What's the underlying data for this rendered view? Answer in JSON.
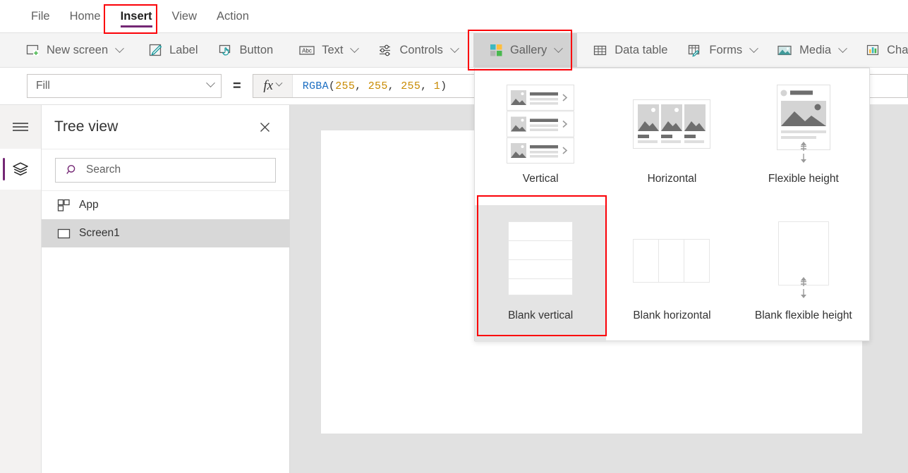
{
  "menubar": {
    "items": [
      {
        "label": "File",
        "active": false
      },
      {
        "label": "Home",
        "active": false
      },
      {
        "label": "Insert",
        "active": true
      },
      {
        "label": "View",
        "active": false
      },
      {
        "label": "Action",
        "active": false
      }
    ]
  },
  "toolbar": {
    "items": [
      {
        "label": "New screen",
        "icon": "new-screen-icon",
        "caret": true,
        "selected": false
      },
      {
        "label": "Label",
        "icon": "label-icon",
        "caret": false,
        "selected": false
      },
      {
        "label": "Button",
        "icon": "button-icon",
        "caret": false,
        "selected": false
      },
      {
        "label": "Text",
        "icon": "text-abc-icon",
        "caret": true,
        "selected": false
      },
      {
        "label": "Controls",
        "icon": "controls-icon",
        "caret": true,
        "selected": false
      },
      {
        "label": "Gallery",
        "icon": "gallery-icon",
        "caret": true,
        "selected": true
      },
      {
        "label": "Data table",
        "icon": "data-table-icon",
        "caret": false,
        "selected": false
      },
      {
        "label": "Forms",
        "icon": "forms-icon",
        "caret": true,
        "selected": false
      },
      {
        "label": "Media",
        "icon": "media-icon",
        "caret": true,
        "selected": false
      },
      {
        "label": "Char",
        "icon": "charts-icon",
        "caret": false,
        "selected": false
      }
    ]
  },
  "formula_bar": {
    "property": "Fill",
    "equals": "=",
    "fx_label": "fx",
    "formula_tokens": [
      {
        "text": "RGBA",
        "type": "fn"
      },
      {
        "text": "(",
        "type": "pun"
      },
      {
        "text": "255",
        "type": "num"
      },
      {
        "text": ", ",
        "type": "pun"
      },
      {
        "text": "255",
        "type": "num"
      },
      {
        "text": ", ",
        "type": "pun"
      },
      {
        "text": "255",
        "type": "num"
      },
      {
        "text": ", ",
        "type": "pun"
      },
      {
        "text": "1",
        "type": "num"
      },
      {
        "text": ")",
        "type": "pun"
      }
    ],
    "formula_plain": "RGBA(255, 255, 255, 1)"
  },
  "rail": {
    "hamburger": "hamburger-icon",
    "layers": "layers-icon"
  },
  "tree_view": {
    "title": "Tree view",
    "close": "✕",
    "search_placeholder": "Search",
    "items": [
      {
        "label": "App",
        "icon": "app-icon",
        "selected": false
      },
      {
        "label": "Screen1",
        "icon": "screen-icon",
        "selected": true
      }
    ]
  },
  "gallery_flyout": {
    "cells": [
      {
        "label": "Vertical",
        "thumb": "vertical-gallery-thumb",
        "selected": false
      },
      {
        "label": "Horizontal",
        "thumb": "horizontal-gallery-thumb",
        "selected": false
      },
      {
        "label": "Flexible height",
        "thumb": "flexible-height-thumb",
        "selected": false
      },
      {
        "label": "Blank vertical",
        "thumb": "blank-vertical-thumb",
        "selected": true
      },
      {
        "label": "Blank horizontal",
        "thumb": "blank-horizontal-thumb",
        "selected": false
      },
      {
        "label": "Blank flexible height",
        "thumb": "blank-flexible-height-thumb",
        "selected": false
      }
    ]
  },
  "colors": {
    "accent_purple": "#742774",
    "annotation_red": "#fb0007",
    "toolbar_bg": "#f4f4f4",
    "selected_bg": "#d2d2d2",
    "canvas_bg": "#e1e1e1",
    "teal": "#0f9599",
    "green": "#49b84f",
    "orange": "#ffbe3d"
  }
}
